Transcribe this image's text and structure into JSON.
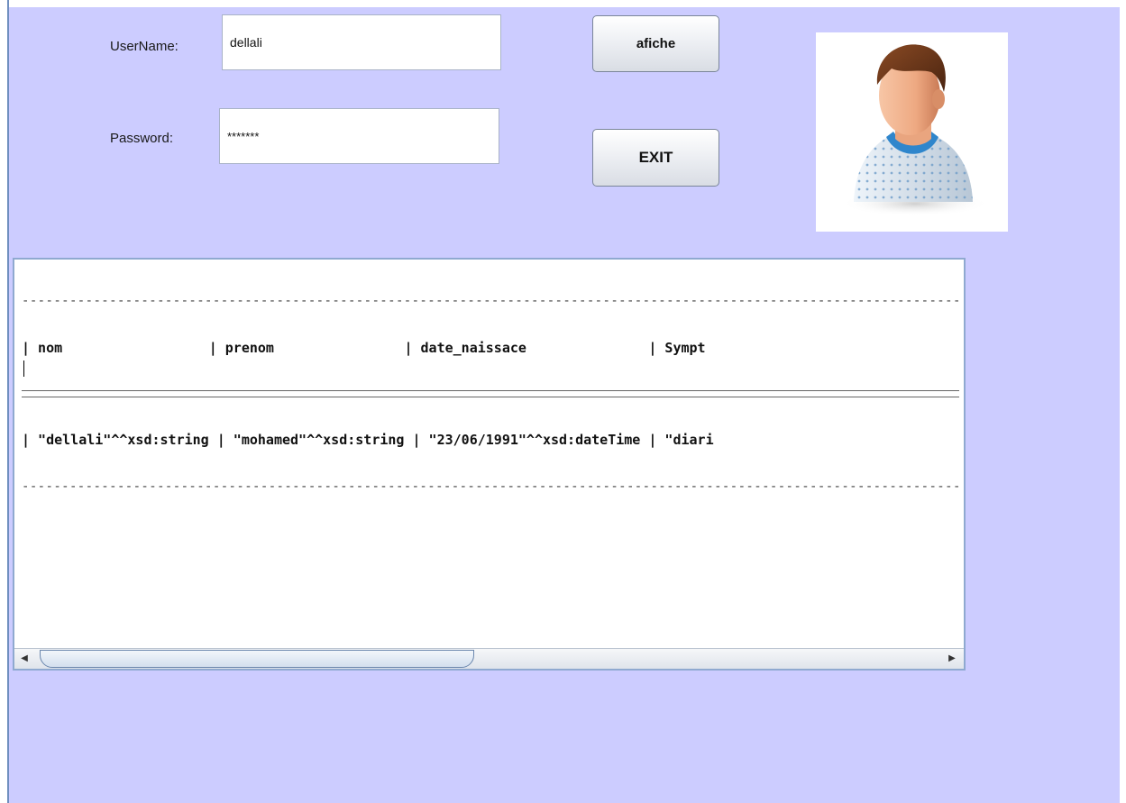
{
  "login": {
    "username_label": "UserName:",
    "username_value": "dellali",
    "password_label": "Password:",
    "password_value": "*******"
  },
  "buttons": {
    "show_label": "afiche",
    "exit_label": "EXIT"
  },
  "avatar": {
    "icon": "patient-avatar-icon"
  },
  "result": {
    "separator": "------------------------------------------------------------------------------------------------------------------------",
    "header": "| nom                  | prenom                | date_naissace               | Sympt",
    "row": "| \"dellali\"^^xsd:string | \"mohamed\"^^xsd:string | \"23/06/1991\"^^xsd:dateTime | \"diari"
  },
  "colors": {
    "background": "#ccccff",
    "panel_border": "#8fa9d0",
    "scroll_thumb_border": "#6a86ad"
  }
}
